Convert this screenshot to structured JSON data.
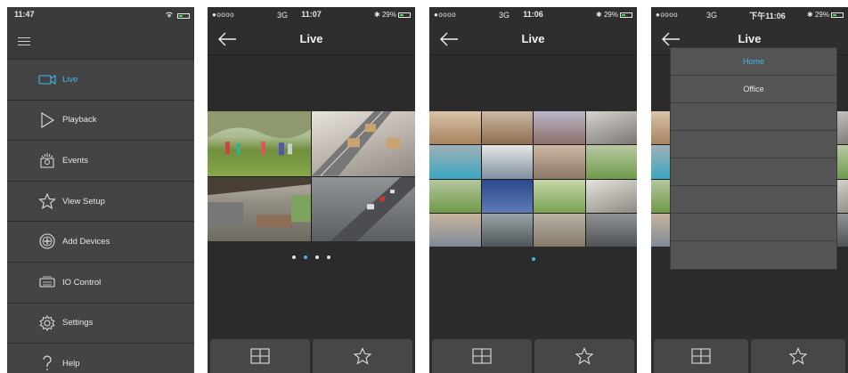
{
  "screens": {
    "menu": {
      "status_time": "11:47",
      "items": [
        {
          "label": "Live",
          "icon": "camera-icon",
          "active": true
        },
        {
          "label": "Playback",
          "icon": "play-icon",
          "active": false
        },
        {
          "label": "Events",
          "icon": "events-icon",
          "active": false
        },
        {
          "label": "View Setup",
          "icon": "star-icon",
          "active": false
        },
        {
          "label": "Add Devices",
          "icon": "add-device-icon",
          "active": false
        },
        {
          "label": "IO Control",
          "icon": "io-control-icon",
          "active": false
        },
        {
          "label": "Settings",
          "icon": "gear-icon",
          "active": false
        },
        {
          "label": "Help",
          "icon": "help-icon",
          "active": false
        }
      ]
    },
    "live_quad": {
      "status_signal": "●oooo",
      "status_network": "3G",
      "status_time": "11:07",
      "status_battery": "29%",
      "title": "Live",
      "page_count": 4,
      "active_page": 1
    },
    "live_grid": {
      "status_signal": "●oooo",
      "status_network": "3G",
      "status_time": "11:06",
      "status_battery": "29%",
      "title": "Live",
      "page_count": 1,
      "active_page": 0
    },
    "live_dropdown": {
      "status_signal": "●oooo",
      "status_network": "3G",
      "status_time": "下午11:06",
      "status_battery": "29%",
      "title": "Live",
      "dropdown": {
        "selected": "Home",
        "options": [
          "Home",
          "Office"
        ]
      }
    }
  },
  "colors": {
    "accent": "#3fb7e8",
    "background": "#2e2e2e",
    "menu_item": "#444444",
    "button": "#474747"
  },
  "icons": {
    "back": "back-arrow-icon",
    "layout": "grid-layout-icon",
    "favorite": "star-icon",
    "menu": "hamburger-icon"
  }
}
